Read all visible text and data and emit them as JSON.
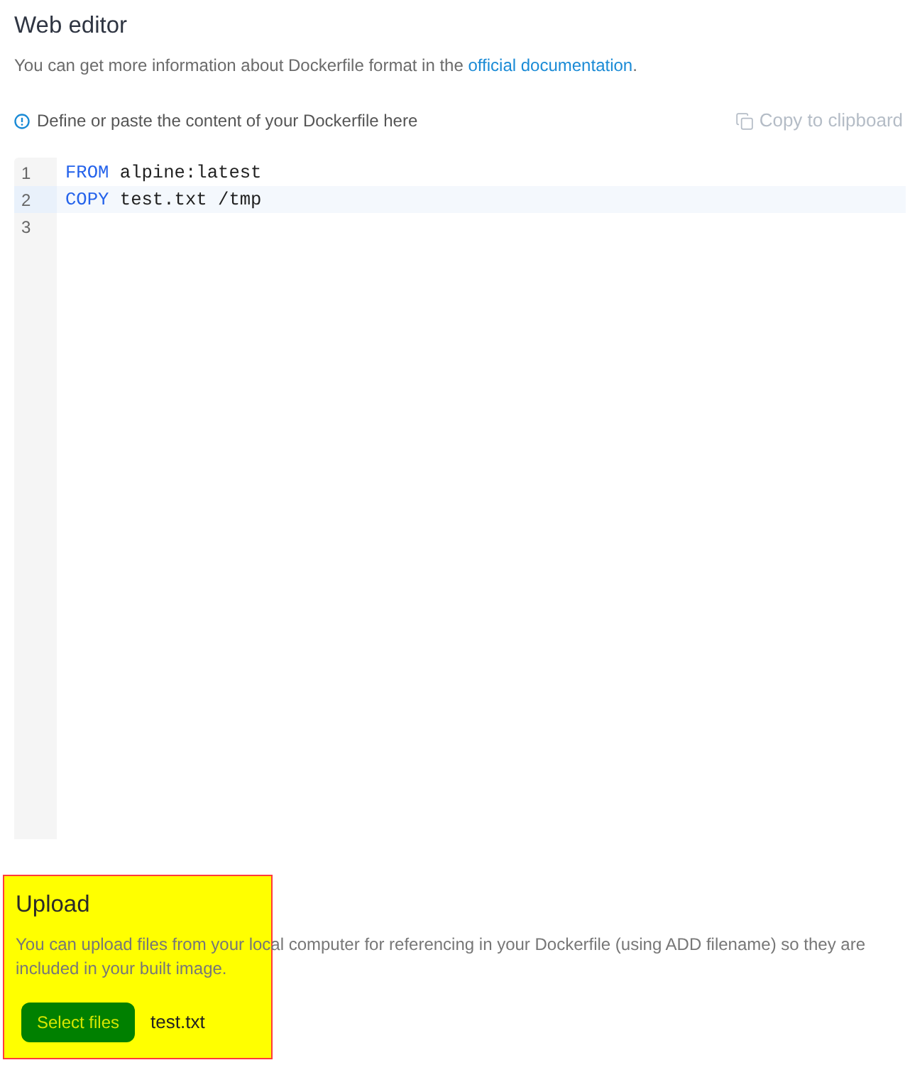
{
  "header": {
    "title": "Web editor",
    "description": {
      "text": "You can get more information about Dockerfile format in the ",
      "link": "official documentation",
      "suffix": "."
    }
  },
  "hint": "Define or paste the content of your Dockerfile here",
  "copy_button": {
    "label": "Copy to clipboard",
    "disabled": true
  },
  "editor": {
    "lines": [
      {
        "number": "1",
        "selected": false,
        "tokens": [
          {
            "kind": "keyword",
            "text": "FROM"
          },
          {
            "kind": "plain",
            "text": " alpine:latest"
          }
        ]
      },
      {
        "number": "2",
        "selected": true,
        "tokens": [
          {
            "kind": "keyword",
            "text": "COPY"
          },
          {
            "kind": "plain",
            "text": " test.txt /tmp"
          }
        ]
      },
      {
        "number": "3",
        "selected": false
      }
    ]
  },
  "upload": {
    "title": "Upload",
    "description": "You can upload files from your local computer for referencing in your Dockerfile (using ADD filename) so they are included in your built image.",
    "button": "Select files",
    "filename": "test.txt"
  }
}
